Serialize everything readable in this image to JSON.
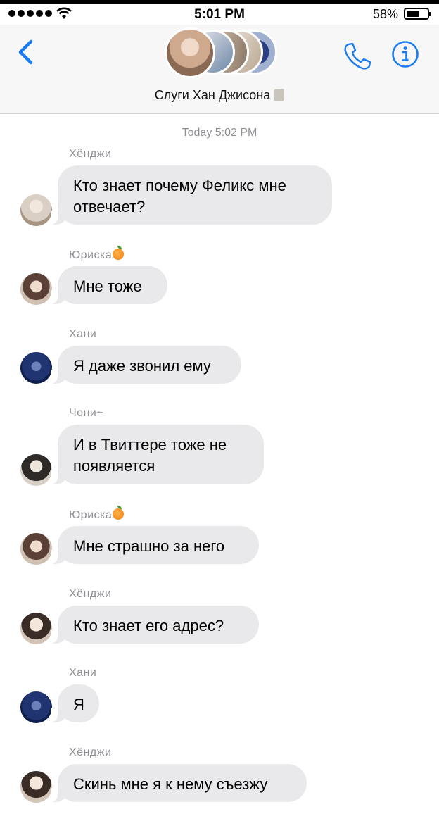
{
  "status_bar": {
    "time": "5:01 PM",
    "battery": "58%"
  },
  "header": {
    "title": "Слуги Хан Джисона"
  },
  "timestamp": "Today 5:02 PM",
  "messages": [
    {
      "sender": "Хёнджи",
      "text": "Кто знает почему Феликс мне отвечает?",
      "orange": false,
      "avatar": "#d9cfc4"
    },
    {
      "sender": "Юриска",
      "text": "Мне тоже",
      "orange": true,
      "avatar": "#bfa89a"
    },
    {
      "sender": "Хани",
      "text": "Я даже звонил ему",
      "orange": false,
      "avatar": "#2c4a8a"
    },
    {
      "sender": "Чони~",
      "text": "И в Твиттере тоже не появляется",
      "orange": false,
      "avatar": "#cfc7bd"
    },
    {
      "sender": "Юриска",
      "text": "Мне страшно за него",
      "orange": true,
      "avatar": "#bfa89a"
    },
    {
      "sender": "Хёнджи",
      "text": "Кто знает его адрес?",
      "orange": false,
      "avatar": "#d9cfc4"
    },
    {
      "sender": "Хани",
      "text": "Я",
      "orange": false,
      "avatar": "#2c4a8a"
    },
    {
      "sender": "Хёнджи",
      "text": "Скинь мне я к нему съезжу",
      "orange": false,
      "avatar": "#d9cfc4"
    }
  ],
  "colors": {
    "accent": "#1a7cf2",
    "bubble": "#e9e9eb",
    "meta": "#8e8e93"
  }
}
